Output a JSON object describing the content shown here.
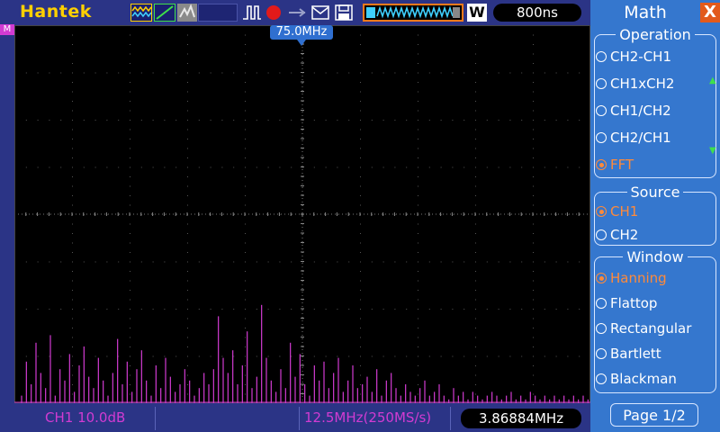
{
  "topbar": {
    "brand": "Hantek",
    "trigger_mode_badge": "W",
    "timebase": "800ns"
  },
  "scope": {
    "trigger_marker_label": "75.0MHz",
    "ch_marker": "M",
    "spectrum_bins": [
      0,
      0.02,
      0.11,
      0.05,
      0.16,
      0.08,
      0.04,
      0.18,
      0.02,
      0.09,
      0.06,
      0.13,
      0.03,
      0.1,
      0.15,
      0.07,
      0.04,
      0.12,
      0.06,
      0.02,
      0.08,
      0.17,
      0.05,
      0.11,
      0.03,
      0.09,
      0.14,
      0.06,
      0.02,
      0.1,
      0.04,
      0.12,
      0.07,
      0.03,
      0.05,
      0.09,
      0.06,
      0.02,
      0.04,
      0.08,
      0.05,
      0.09,
      0.23,
      0.12,
      0.08,
      0.14,
      0.05,
      0.1,
      0.19,
      0.04,
      0.07,
      0.26,
      0.12,
      0.06,
      0.03,
      0.09,
      0.04,
      0.16,
      0.07,
      0.13,
      0.05,
      0.02,
      0.1,
      0.06,
      0.11,
      0.04,
      0.08,
      0.12,
      0.03,
      0.06,
      0.1,
      0.04,
      0.05,
      0.07,
      0.03,
      0.09,
      0.02,
      0.06,
      0.08,
      0.04,
      0.02,
      0.05,
      0.03,
      0.02,
      0.04,
      0.06,
      0.02,
      0.03,
      0.05,
      0.02,
      0.01,
      0.04,
      0.02,
      0.03,
      0.01,
      0.03,
      0.02,
      0.01,
      0.02,
      0.03,
      0.02,
      0.01,
      0.02,
      0.03,
      0.01,
      0.02,
      0.01,
      0.03,
      0.02,
      0.01,
      0.02,
      0.01,
      0.02,
      0.01,
      0.02,
      0.01,
      0.02,
      0.01,
      0.02,
      0.01
    ]
  },
  "bottombar": {
    "ch1_scale": "CH1 10.0dB",
    "span": "12.5MHz(250MS/s)",
    "cursor_freq": "3.86884MHz"
  },
  "panel": {
    "title": "Math",
    "close": "X",
    "operation": {
      "title": "Operation",
      "options": [
        "CH2-CH1",
        "CH1xCH2",
        "CH1/CH2",
        "CH2/CH1",
        "FFT"
      ],
      "selected": "FFT"
    },
    "source": {
      "title": "Source",
      "options": [
        "CH1",
        "CH2"
      ],
      "selected": "CH1"
    },
    "window": {
      "title": "Window",
      "options": [
        "Hanning",
        "Flattop",
        "Rectangular",
        "Bartlett",
        "Blackman"
      ],
      "selected": "Hanning"
    },
    "page": "Page 1/2"
  },
  "colors": {
    "trace": "#d23bd2",
    "panel_bg": "#3577ce",
    "bar_bg": "#2b3486",
    "selected": "#ff8a3a",
    "brand": "#ffd000"
  }
}
